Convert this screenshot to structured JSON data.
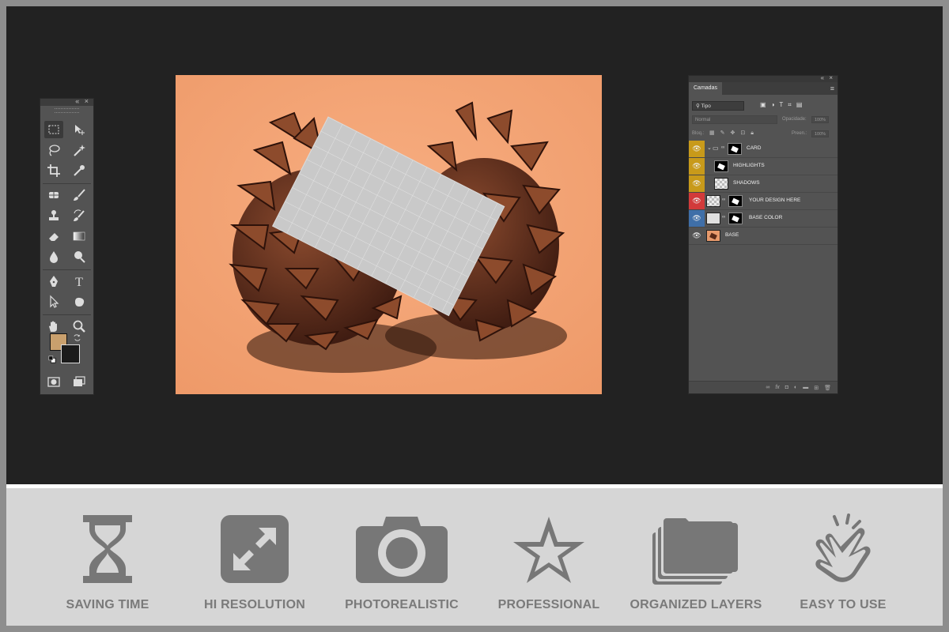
{
  "tools_panel": {
    "header_controls": "« ×",
    "foreground_color": "#c9a06d",
    "background_color": "#1b1b1b",
    "tools": [
      "rectangular-marquee",
      "move",
      "lasso",
      "magic-wand",
      "crop",
      "eyedropper",
      "healing-brush",
      "brush",
      "clone-stamp",
      "history-brush",
      "eraser",
      "gradient",
      "blur",
      "dodge",
      "pen",
      "type",
      "path-selection",
      "custom-shape",
      "hand",
      "zoom",
      "quick-mask",
      "screen-mode"
    ]
  },
  "canvas": {
    "background_color": "#f5a779",
    "card_color": "#c9c9c9"
  },
  "layers_panel": {
    "header_controls": "« ×",
    "tab_label": "Camadas",
    "filter_label": "Tipo",
    "blend_mode": "Normal",
    "opacity_label": "Opacidade:",
    "opacity_value": "100%",
    "lock_label": "Bloq.:",
    "fill_label": "Preen.:",
    "fill_value": "100%",
    "layers": [
      {
        "name": "CARD",
        "color": "#c89a1a",
        "type": "group"
      },
      {
        "name": "HIGHLIGHTS",
        "color": "#c89a1a",
        "type": "layer"
      },
      {
        "name": "SHADOWS",
        "color": "#c89a1a",
        "type": "layer"
      },
      {
        "name": "YOUR DESIGN HERE",
        "color": "#d23a3a",
        "type": "smart-object"
      },
      {
        "name": "BASE COLOR",
        "color": "#3f6fa8",
        "type": "layer"
      },
      {
        "name": "BASE",
        "color": "#535353",
        "type": "layer"
      }
    ]
  },
  "features": [
    {
      "label": "SAVING TIME",
      "icon": "hourglass-icon"
    },
    {
      "label": "HI RESOLUTION",
      "icon": "expand-arrows-icon"
    },
    {
      "label": "PHOTOREALISTIC",
      "icon": "camera-icon"
    },
    {
      "label": "PROFESSIONAL",
      "icon": "star-icon"
    },
    {
      "label": "ORGANIZED LAYERS",
      "icon": "stacked-folders-icon"
    },
    {
      "label": "EASY TO USE",
      "icon": "pointing-hand-icon"
    }
  ],
  "colors": {
    "workspace": "#222222",
    "feature_strip": "#d6d6d6",
    "feature_icon": "#777777"
  }
}
